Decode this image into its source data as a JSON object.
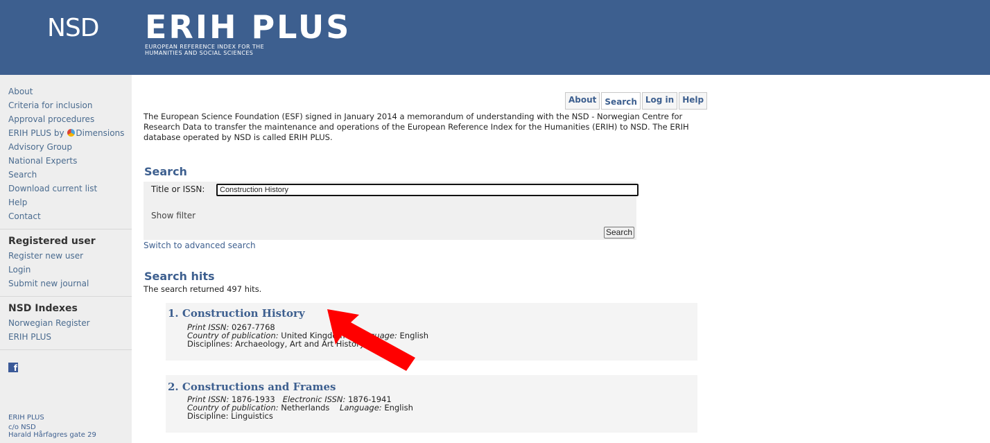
{
  "header": {
    "nsd_logo": "NSD",
    "erih_logo": "ERIH PLUS",
    "erih_subtitle_line1": "EUROPEAN REFERENCE INDEX FOR THE",
    "erih_subtitle_line2": "HUMANITIES AND SOCIAL SCIENCES"
  },
  "sidebar": {
    "links": [
      {
        "label": "About"
      },
      {
        "label": "Criteria for inclusion"
      },
      {
        "label": "Approval procedures"
      },
      {
        "label_pre": "ERIH PLUS by ",
        "label_post": "Dimensions"
      },
      {
        "label": "Advisory Group"
      },
      {
        "label": "National Experts"
      },
      {
        "label": "Search"
      },
      {
        "label": "Download current list"
      },
      {
        "label": "Help"
      },
      {
        "label": "Contact"
      }
    ],
    "registered_heading": "Registered user",
    "registered_links": [
      "Register new user",
      "Login",
      "Submit new journal"
    ],
    "nsd_heading": "NSD Indexes",
    "nsd_links": [
      "Norwegian Register",
      "ERIH PLUS"
    ],
    "facebook_icon": "f",
    "footer": [
      "ERIH PLUS",
      "c/o NSD",
      "Harald Hårfagres gate 29"
    ]
  },
  "tabs": [
    "About",
    "Search",
    "Log in",
    "Help"
  ],
  "intro": "The European Science Foundation (ESF) signed in January 2014 a memorandum of understanding with the NSD - Norwegian Centre for Research Data to transfer the maintenance and operations of the European Reference Index for the Humanities (ERIH) to NSD. The ERIH database operated by NSD is called ERIH PLUS.",
  "search": {
    "heading": "Search",
    "label": "Title or ISSN:",
    "value": "Construction History",
    "show_filter": "Show filter",
    "button": "Search",
    "advanced": "Switch to advanced search"
  },
  "hits": {
    "heading": "Search hits",
    "count_text": "The search returned 497 hits.",
    "results": [
      {
        "title": "1.  Construction History",
        "line1_label": "Print ISSN:",
        "line1_value": " 0267-7768",
        "line2_label": "Country of publication:",
        "line2_value": " United Kingdom",
        "line2_label_b": "Language:",
        "line2_value_b": " English",
        "line3": "Disciplines: Archaeology, Art and Art History, ..."
      },
      {
        "title": "2.  Constructions and Frames",
        "line1_label": "Print ISSN:",
        "line1_value": " 1876-1933",
        "line1_label_b": "Electronic ISSN:",
        "line1_value_b": " 1876-1941",
        "line2_label": "Country of publication:",
        "line2_value": " Netherlands",
        "line2_label_b": "Language:",
        "line2_value_b": " English",
        "line3": "Discipline: Linguistics"
      }
    ]
  },
  "colors": {
    "header_bg": "#3d5f8f",
    "link": "#4a6b8f",
    "arrow": "#ff0000"
  }
}
